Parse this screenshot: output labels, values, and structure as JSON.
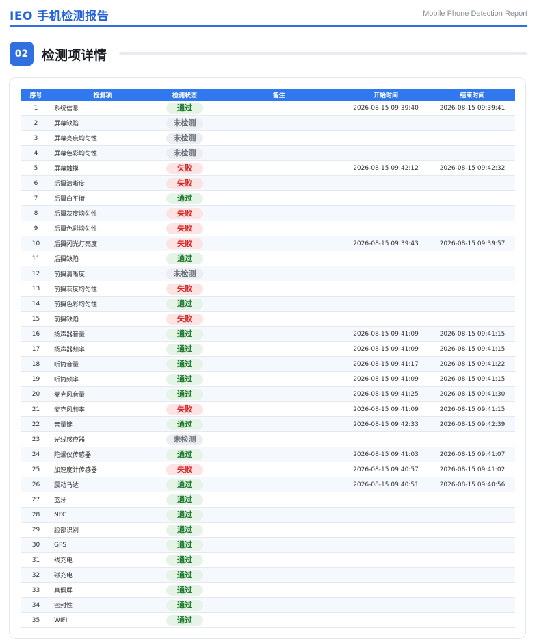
{
  "header": {
    "brand": "IEO 手机检测报告",
    "subtitle": "Mobile Phone Detection Report"
  },
  "section": {
    "number": "02",
    "title": "检测项详情"
  },
  "table": {
    "columns": [
      "序号",
      "检测项",
      "检测状态",
      "备注",
      "开始时间",
      "结束时间"
    ],
    "rows": [
      {
        "idx": "1",
        "item": "系统信息",
        "status": "通过",
        "type": "pass",
        "note": "",
        "start": "2026-08-15 09:39:40",
        "end": "2026-08-15 09:39:41"
      },
      {
        "idx": "2",
        "item": "屏幕缺陷",
        "status": "未检测",
        "type": "none",
        "note": "",
        "start": "",
        "end": ""
      },
      {
        "idx": "3",
        "item": "屏幕亮度均匀性",
        "status": "未检测",
        "type": "none",
        "note": "",
        "start": "",
        "end": ""
      },
      {
        "idx": "4",
        "item": "屏幕色彩均匀性",
        "status": "未检测",
        "type": "none",
        "note": "",
        "start": "",
        "end": ""
      },
      {
        "idx": "5",
        "item": "屏幕触摸",
        "status": "失败",
        "type": "fail",
        "note": "",
        "start": "2026-08-15 09:42:12",
        "end": "2026-08-15 09:42:32"
      },
      {
        "idx": "6",
        "item": "后摄清晰度",
        "status": "失败",
        "type": "fail",
        "note": "",
        "start": "",
        "end": ""
      },
      {
        "idx": "7",
        "item": "后摄白平衡",
        "status": "通过",
        "type": "pass",
        "note": "",
        "start": "",
        "end": ""
      },
      {
        "idx": "8",
        "item": "后摄灰度均匀性",
        "status": "失败",
        "type": "fail",
        "note": "",
        "start": "",
        "end": ""
      },
      {
        "idx": "9",
        "item": "后摄色彩均匀性",
        "status": "失败",
        "type": "fail",
        "note": "",
        "start": "",
        "end": ""
      },
      {
        "idx": "10",
        "item": "后摄闪光灯亮度",
        "status": "失败",
        "type": "fail",
        "note": "",
        "start": "2026-08-15 09:39:43",
        "end": "2026-08-15 09:39:57"
      },
      {
        "idx": "11",
        "item": "后摄缺陷",
        "status": "通过",
        "type": "pass",
        "note": "",
        "start": "",
        "end": ""
      },
      {
        "idx": "12",
        "item": "前摄清晰度",
        "status": "未检测",
        "type": "none",
        "note": "",
        "start": "",
        "end": ""
      },
      {
        "idx": "13",
        "item": "前摄灰度均匀性",
        "status": "失败",
        "type": "fail",
        "note": "",
        "start": "",
        "end": ""
      },
      {
        "idx": "14",
        "item": "前摄色彩均匀性",
        "status": "通过",
        "type": "pass",
        "note": "",
        "start": "",
        "end": ""
      },
      {
        "idx": "15",
        "item": "前摄缺陷",
        "status": "失败",
        "type": "fail",
        "note": "",
        "start": "",
        "end": ""
      },
      {
        "idx": "16",
        "item": "扬声器音量",
        "status": "通过",
        "type": "pass",
        "note": "",
        "start": "2026-08-15 09:41:09",
        "end": "2026-08-15 09:41:15"
      },
      {
        "idx": "17",
        "item": "扬声器频率",
        "status": "通过",
        "type": "pass",
        "note": "",
        "start": "2026-08-15 09:41:09",
        "end": "2026-08-15 09:41:15"
      },
      {
        "idx": "18",
        "item": "听筒音量",
        "status": "通过",
        "type": "pass",
        "note": "",
        "start": "2026-08-15 09:41:17",
        "end": "2026-08-15 09:41:22"
      },
      {
        "idx": "19",
        "item": "听筒频率",
        "status": "通过",
        "type": "pass",
        "note": "",
        "start": "2026-08-15 09:41:09",
        "end": "2026-08-15 09:41:15"
      },
      {
        "idx": "20",
        "item": "麦克风音量",
        "status": "通过",
        "type": "pass",
        "note": "",
        "start": "2026-08-15 09:41:25",
        "end": "2026-08-15 09:41:30"
      },
      {
        "idx": "21",
        "item": "麦克风频率",
        "status": "失败",
        "type": "fail",
        "note": "",
        "start": "2026-08-15 09:41:09",
        "end": "2026-08-15 09:41:15"
      },
      {
        "idx": "22",
        "item": "音量键",
        "status": "通过",
        "type": "pass",
        "note": "",
        "start": "2026-08-15 09:42:33",
        "end": "2026-08-15 09:42:39"
      },
      {
        "idx": "23",
        "item": "光线感应器",
        "status": "未检测",
        "type": "none",
        "note": "",
        "start": "",
        "end": ""
      },
      {
        "idx": "24",
        "item": "陀螺仪传感器",
        "status": "通过",
        "type": "pass",
        "note": "",
        "start": "2026-08-15 09:41:03",
        "end": "2026-08-15 09:41:07"
      },
      {
        "idx": "25",
        "item": "加速度计传感器",
        "status": "失败",
        "type": "fail",
        "note": "",
        "start": "2026-08-15 09:40:57",
        "end": "2026-08-15 09:41:02"
      },
      {
        "idx": "26",
        "item": "震动马达",
        "status": "通过",
        "type": "pass",
        "note": "",
        "start": "2026-08-15 09:40:51",
        "end": "2026-08-15 09:40:56"
      },
      {
        "idx": "27",
        "item": "蓝牙",
        "status": "通过",
        "type": "pass",
        "note": "",
        "start": "",
        "end": ""
      },
      {
        "idx": "28",
        "item": "NFC",
        "status": "通过",
        "type": "pass",
        "note": "",
        "start": "",
        "end": ""
      },
      {
        "idx": "29",
        "item": "脸部识别",
        "status": "通过",
        "type": "pass",
        "note": "",
        "start": "",
        "end": ""
      },
      {
        "idx": "30",
        "item": "GPS",
        "status": "通过",
        "type": "pass",
        "note": "",
        "start": "",
        "end": ""
      },
      {
        "idx": "31",
        "item": "线充电",
        "status": "通过",
        "type": "pass",
        "note": "",
        "start": "",
        "end": ""
      },
      {
        "idx": "32",
        "item": "磁充电",
        "status": "通过",
        "type": "pass",
        "note": "",
        "start": "",
        "end": ""
      },
      {
        "idx": "33",
        "item": "真假屏",
        "status": "通过",
        "type": "pass",
        "note": "",
        "start": "",
        "end": ""
      },
      {
        "idx": "34",
        "item": "密封性",
        "status": "通过",
        "type": "pass",
        "note": "",
        "start": "",
        "end": ""
      },
      {
        "idx": "35",
        "item": "WIFI",
        "status": "通过",
        "type": "pass",
        "note": "",
        "start": "",
        "end": ""
      }
    ]
  }
}
